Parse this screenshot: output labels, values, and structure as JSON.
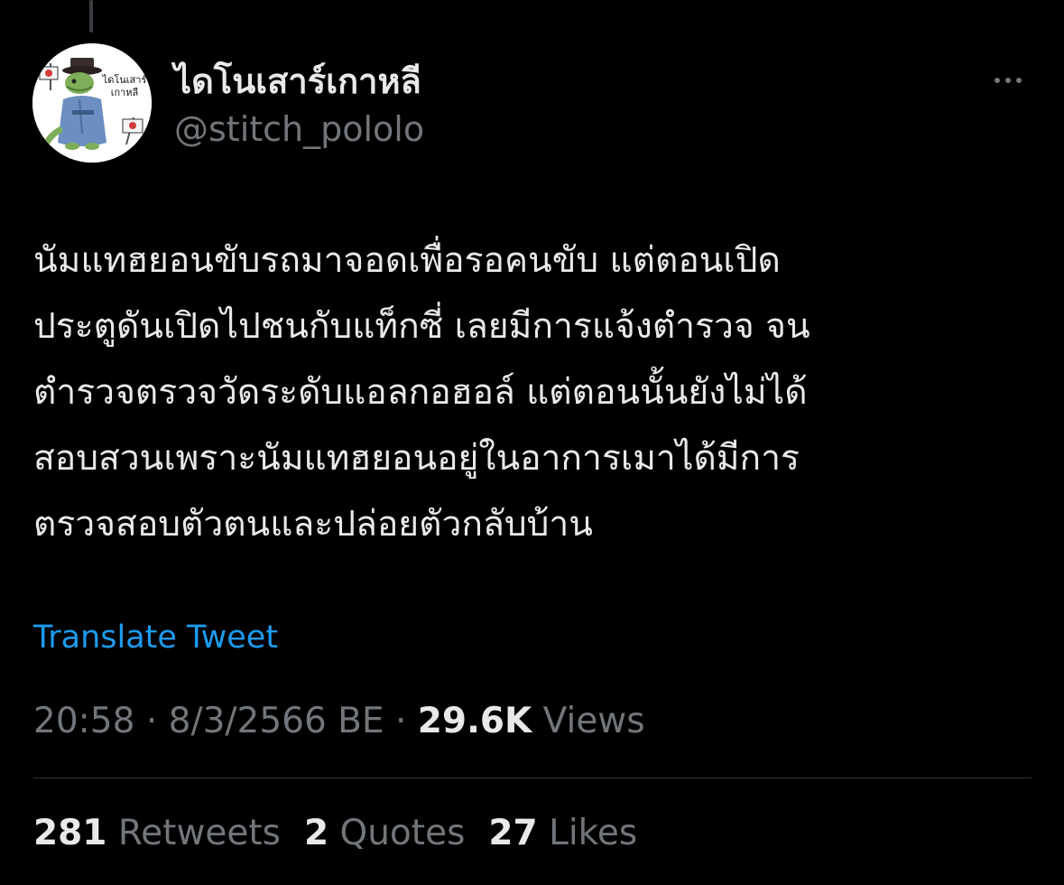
{
  "author": {
    "display_name": "ไดโนเสาร์เกาหลี",
    "handle": "@stitch_pololo",
    "avatar": {
      "badge_line1": "ไดโนเสาร์",
      "badge_line2": "เกาหลี"
    }
  },
  "tweet": {
    "lines": [
      "นัมแทฮยอนขับรถมาจอดเพื่อรอคนขับ แต่ตอนเปิด",
      "ประตูดันเปิดไปชนกับแท็กซี่ เลยมีการแจ้งตำรวจ จน",
      "ตำรวจตรวจวัดระดับแอลกอฮอล์ แต่ตอนนั้นยังไม่ได้",
      "สอบสวนเพราะนัมแทฮยอนอยู่ในอาการเมาได้มีการ",
      "ตรวจสอบตัวตนและปล่อยตัวกลับบ้าน"
    ],
    "translate_label": "Translate Tweet"
  },
  "meta": {
    "time": "20:58",
    "separator": "·",
    "date": "8/3/2566 BE",
    "views_count": "29.6K",
    "views_label": "Views"
  },
  "stats": {
    "retweets_count": "281",
    "retweets_label": "Retweets",
    "quotes_count": "2",
    "quotes_label": "Quotes",
    "likes_count": "27",
    "likes_label": "Likes"
  },
  "icons": {
    "more": "more-horizontal-icon"
  },
  "colors": {
    "background": "#000000",
    "primary_text": "#e7e9ea",
    "secondary_text": "#71767b",
    "link": "#1d9bf0",
    "divider": "#2f3336"
  }
}
